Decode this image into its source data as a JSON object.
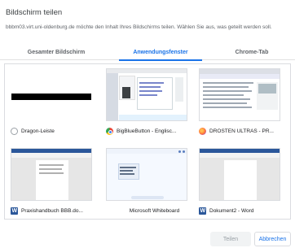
{
  "dialog": {
    "title": "Bildschirm teilen",
    "description": "bbbm03.virt.uni-oldenburg.de möchte den Inhalt Ihres Bildschirms teilen. Wählen Sie aus, was geteilt werden soll."
  },
  "tabs": [
    {
      "label": "Gesamter Bildschirm",
      "selected": false
    },
    {
      "label": "Anwendungsfenster",
      "selected": true
    },
    {
      "label": "Chrome-Tab",
      "selected": false
    }
  ],
  "windows": [
    {
      "label": "Dragon-Leiste",
      "icon": "dragon-icon"
    },
    {
      "label": "BigBlueButton - Englisc...",
      "icon": "chrome-icon"
    },
    {
      "label": "DROSTEN ULTRAS - PR...",
      "icon": "firefox-icon"
    },
    {
      "label": "Praxishandbuch BBB.do...",
      "icon": "word-icon"
    },
    {
      "label": "Microsoft Whiteboard",
      "icon": "whiteboard-icon"
    },
    {
      "label": "Dokument2 - Word",
      "icon": "word-icon"
    }
  ],
  "buttons": {
    "share_label": "Teilen",
    "cancel_label": "Abbrechen"
  },
  "colors": {
    "accent": "#1a73e8",
    "disabled": "#9aa0a6"
  }
}
